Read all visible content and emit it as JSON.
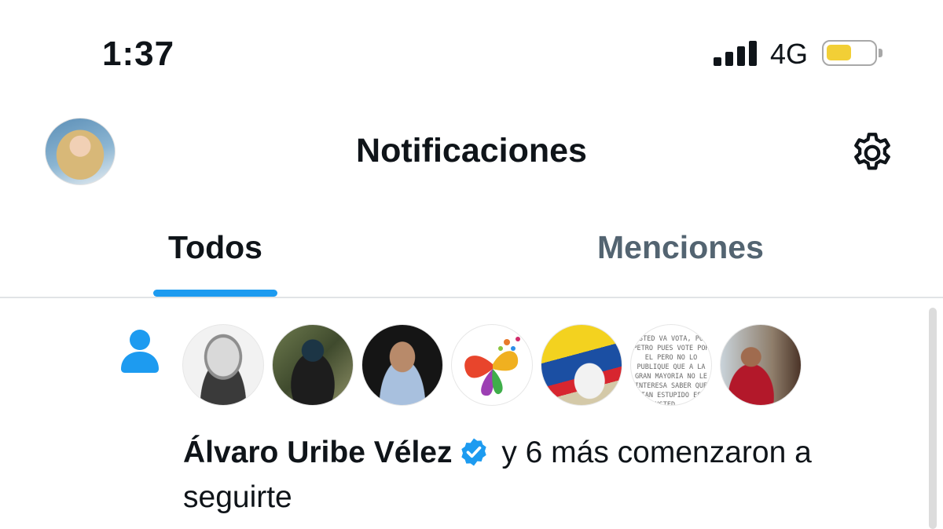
{
  "status_bar": {
    "time": "1:37",
    "network": "4G",
    "battery_level": 0.55
  },
  "header": {
    "title": "Notificaciones",
    "settings_icon": "gear-icon"
  },
  "tabs": [
    {
      "label": "Todos",
      "active": true
    },
    {
      "label": "Menciones",
      "active": false
    }
  ],
  "notification": {
    "icon": "person-icon",
    "user": "Álvaro Uribe Vélez",
    "message": "y 6 más comenzaron a seguirte",
    "avatar_count": 7,
    "avatar6_text": "USTED VA VOTA, POR PETRO PUES VOTE POR EL PERO NO LO PUBLIQUE QUE A LA GRAN MAYORIA NO LE INTERESA SABER QUE TAN ESTUPIDO ES USTED..."
  },
  "colors": {
    "accent": "#1d9bf0",
    "text": "#0f1419",
    "muted": "#536471",
    "battery": "#f2cf36"
  }
}
